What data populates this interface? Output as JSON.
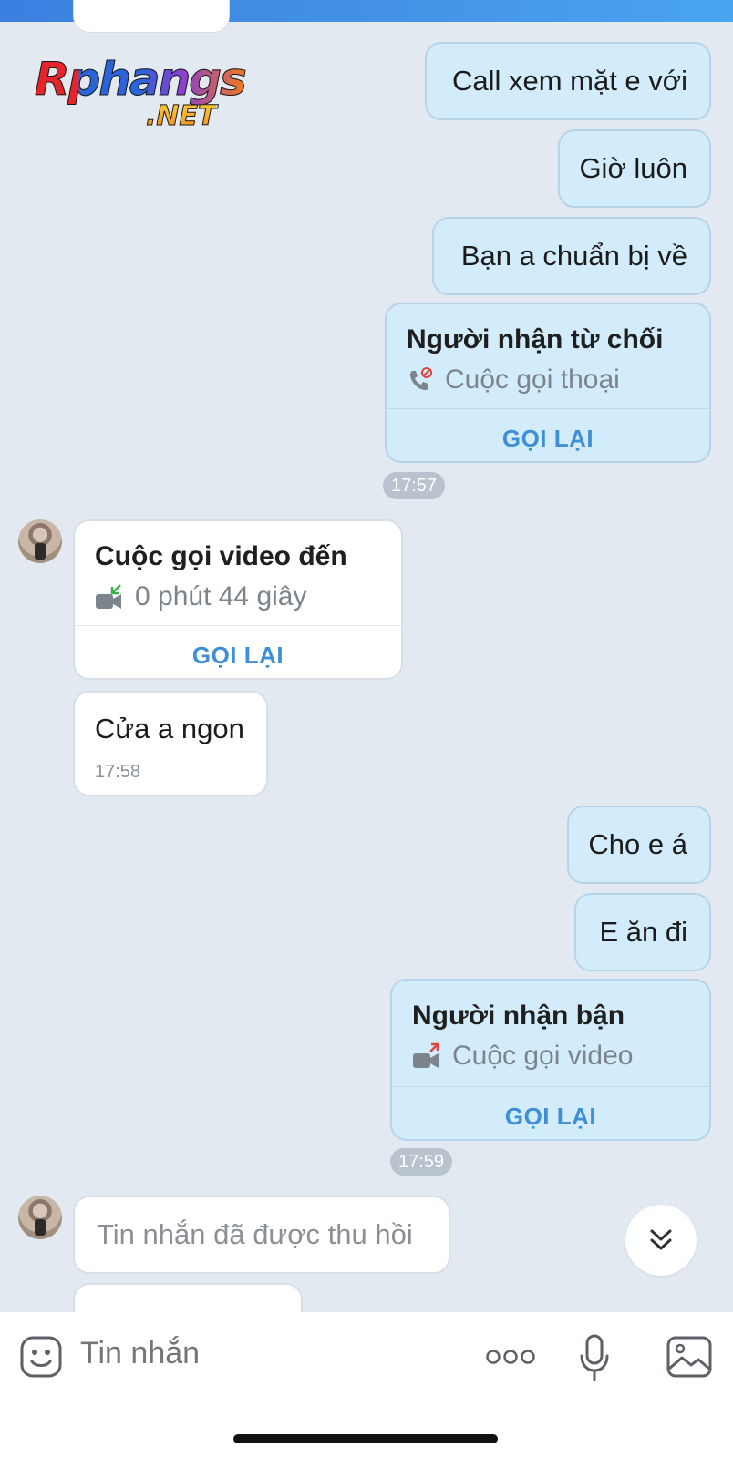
{
  "watermark": {
    "main": "Rphangs",
    "sub": ".NET"
  },
  "messages": {
    "m1": "Call xem mặt e với",
    "m2": "Giờ luôn",
    "m3": "Bạn a chuẩn bị về",
    "call1": {
      "title": "Người nhận từ chối",
      "subtitle": "Cuộc gọi thoại",
      "action": "GỌI LẠI",
      "icon": "phone-declined-icon"
    },
    "time1": "17:57",
    "call2": {
      "title": "Cuộc gọi video đến",
      "subtitle": "0 phút 44 giây",
      "action": "GỌI LẠI",
      "icon": "video-incoming-icon"
    },
    "m4": {
      "text": "Cửa a ngon",
      "time": "17:58"
    },
    "m5": "Cho e á",
    "m6": "E ăn đi",
    "call3": {
      "title": "Người nhận bận",
      "subtitle": "Cuộc gọi video",
      "action": "GỌI LẠI",
      "icon": "video-outgoing-icon"
    },
    "time2": "17:59",
    "m7": "Tin nhắn đã được thu hồi"
  },
  "composer": {
    "placeholder": "Tin nhắn",
    "icons": [
      "emoji-icon",
      "more-icon",
      "microphone-icon",
      "image-icon"
    ]
  },
  "colors": {
    "outgoing_bubble": "#d3ecfc",
    "incoming_bubble": "#ffffff",
    "background": "#e2e9f1",
    "action_blue": "#3f8fd6"
  }
}
